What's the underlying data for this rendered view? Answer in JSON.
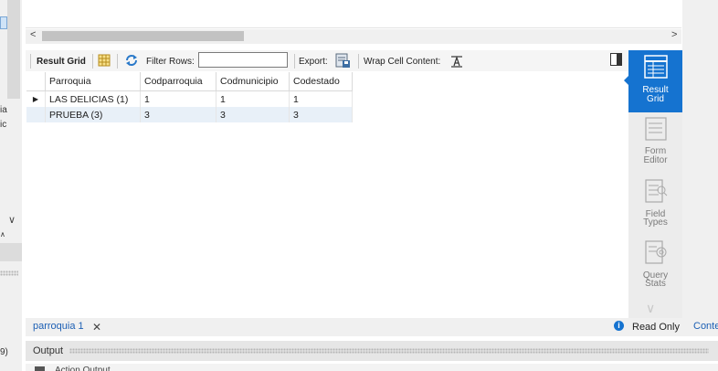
{
  "left_strip": {
    "fragments": [
      "ia",
      "ic",
      "∧",
      "9)"
    ],
    "chevron": "∨"
  },
  "scroll": {
    "left_arrow": "<",
    "right_arrow": ">"
  },
  "toolbar": {
    "result_grid_label": "Result Grid",
    "filter_rows_label": "Filter Rows:",
    "filter_value": "",
    "export_label": "Export:",
    "wrap_label": "Wrap Cell Content:",
    "icons": [
      "grid-layout-icon",
      "refresh-icon",
      "export-icon",
      "wrap-text-icon",
      "panel-toggle-icon"
    ]
  },
  "grid": {
    "columns": [
      "Parroquia",
      "Codparroquia",
      "Codmunicipio",
      "Codestado"
    ],
    "rows": [
      [
        "LAS DELICIAS (1)",
        "1",
        "1",
        "1"
      ],
      [
        "PRUEBA (3)",
        "3",
        "3",
        "3"
      ]
    ],
    "current_row_marker": "▶"
  },
  "right_panel": {
    "items": [
      {
        "label_line1": "Result",
        "label_line2": "Grid",
        "active": true
      },
      {
        "label_line1": "Form",
        "label_line2": "Editor",
        "active": false
      },
      {
        "label_line1": "Field",
        "label_line2": "Types",
        "active": false
      },
      {
        "label_line1": "Query",
        "label_line2": "Stats",
        "active": false
      }
    ],
    "more": "∨"
  },
  "tabbar": {
    "tab_label": "parroquia 1",
    "close": "✕",
    "info": "i",
    "status": "Read Only",
    "right_tab": "Conte"
  },
  "output": {
    "label": "Output",
    "partial": "Action Output"
  },
  "colors": {
    "accent": "#1573d0",
    "link": "#1c5fb4",
    "alt_row": "#e8f0f8"
  }
}
